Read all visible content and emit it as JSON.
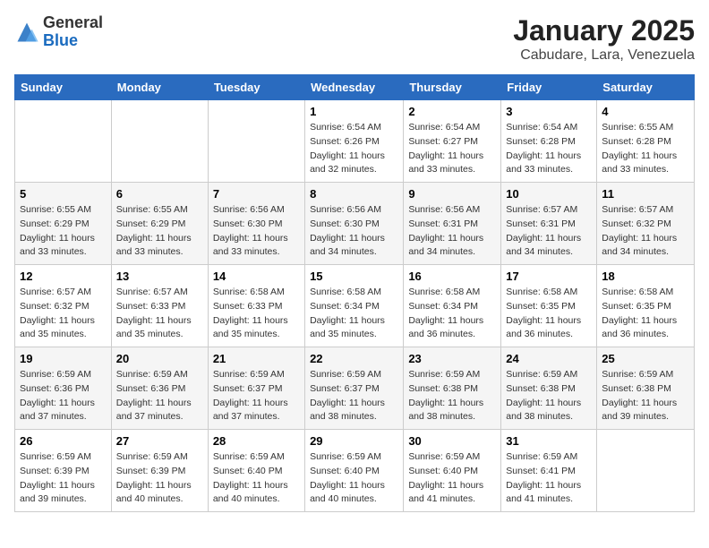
{
  "header": {
    "logo_general": "General",
    "logo_blue": "Blue",
    "month_title": "January 2025",
    "subtitle": "Cabudare, Lara, Venezuela"
  },
  "days_of_week": [
    "Sunday",
    "Monday",
    "Tuesday",
    "Wednesday",
    "Thursday",
    "Friday",
    "Saturday"
  ],
  "weeks": [
    [
      {
        "day": "",
        "sunrise": "",
        "sunset": "",
        "daylight": ""
      },
      {
        "day": "",
        "sunrise": "",
        "sunset": "",
        "daylight": ""
      },
      {
        "day": "",
        "sunrise": "",
        "sunset": "",
        "daylight": ""
      },
      {
        "day": "1",
        "sunrise": "Sunrise: 6:54 AM",
        "sunset": "Sunset: 6:26 PM",
        "daylight": "Daylight: 11 hours and 32 minutes."
      },
      {
        "day": "2",
        "sunrise": "Sunrise: 6:54 AM",
        "sunset": "Sunset: 6:27 PM",
        "daylight": "Daylight: 11 hours and 33 minutes."
      },
      {
        "day": "3",
        "sunrise": "Sunrise: 6:54 AM",
        "sunset": "Sunset: 6:28 PM",
        "daylight": "Daylight: 11 hours and 33 minutes."
      },
      {
        "day": "4",
        "sunrise": "Sunrise: 6:55 AM",
        "sunset": "Sunset: 6:28 PM",
        "daylight": "Daylight: 11 hours and 33 minutes."
      }
    ],
    [
      {
        "day": "5",
        "sunrise": "Sunrise: 6:55 AM",
        "sunset": "Sunset: 6:29 PM",
        "daylight": "Daylight: 11 hours and 33 minutes."
      },
      {
        "day": "6",
        "sunrise": "Sunrise: 6:55 AM",
        "sunset": "Sunset: 6:29 PM",
        "daylight": "Daylight: 11 hours and 33 minutes."
      },
      {
        "day": "7",
        "sunrise": "Sunrise: 6:56 AM",
        "sunset": "Sunset: 6:30 PM",
        "daylight": "Daylight: 11 hours and 33 minutes."
      },
      {
        "day": "8",
        "sunrise": "Sunrise: 6:56 AM",
        "sunset": "Sunset: 6:30 PM",
        "daylight": "Daylight: 11 hours and 34 minutes."
      },
      {
        "day": "9",
        "sunrise": "Sunrise: 6:56 AM",
        "sunset": "Sunset: 6:31 PM",
        "daylight": "Daylight: 11 hours and 34 minutes."
      },
      {
        "day": "10",
        "sunrise": "Sunrise: 6:57 AM",
        "sunset": "Sunset: 6:31 PM",
        "daylight": "Daylight: 11 hours and 34 minutes."
      },
      {
        "day": "11",
        "sunrise": "Sunrise: 6:57 AM",
        "sunset": "Sunset: 6:32 PM",
        "daylight": "Daylight: 11 hours and 34 minutes."
      }
    ],
    [
      {
        "day": "12",
        "sunrise": "Sunrise: 6:57 AM",
        "sunset": "Sunset: 6:32 PM",
        "daylight": "Daylight: 11 hours and 35 minutes."
      },
      {
        "day": "13",
        "sunrise": "Sunrise: 6:57 AM",
        "sunset": "Sunset: 6:33 PM",
        "daylight": "Daylight: 11 hours and 35 minutes."
      },
      {
        "day": "14",
        "sunrise": "Sunrise: 6:58 AM",
        "sunset": "Sunset: 6:33 PM",
        "daylight": "Daylight: 11 hours and 35 minutes."
      },
      {
        "day": "15",
        "sunrise": "Sunrise: 6:58 AM",
        "sunset": "Sunset: 6:34 PM",
        "daylight": "Daylight: 11 hours and 35 minutes."
      },
      {
        "day": "16",
        "sunrise": "Sunrise: 6:58 AM",
        "sunset": "Sunset: 6:34 PM",
        "daylight": "Daylight: 11 hours and 36 minutes."
      },
      {
        "day": "17",
        "sunrise": "Sunrise: 6:58 AM",
        "sunset": "Sunset: 6:35 PM",
        "daylight": "Daylight: 11 hours and 36 minutes."
      },
      {
        "day": "18",
        "sunrise": "Sunrise: 6:58 AM",
        "sunset": "Sunset: 6:35 PM",
        "daylight": "Daylight: 11 hours and 36 minutes."
      }
    ],
    [
      {
        "day": "19",
        "sunrise": "Sunrise: 6:59 AM",
        "sunset": "Sunset: 6:36 PM",
        "daylight": "Daylight: 11 hours and 37 minutes."
      },
      {
        "day": "20",
        "sunrise": "Sunrise: 6:59 AM",
        "sunset": "Sunset: 6:36 PM",
        "daylight": "Daylight: 11 hours and 37 minutes."
      },
      {
        "day": "21",
        "sunrise": "Sunrise: 6:59 AM",
        "sunset": "Sunset: 6:37 PM",
        "daylight": "Daylight: 11 hours and 37 minutes."
      },
      {
        "day": "22",
        "sunrise": "Sunrise: 6:59 AM",
        "sunset": "Sunset: 6:37 PM",
        "daylight": "Daylight: 11 hours and 38 minutes."
      },
      {
        "day": "23",
        "sunrise": "Sunrise: 6:59 AM",
        "sunset": "Sunset: 6:38 PM",
        "daylight": "Daylight: 11 hours and 38 minutes."
      },
      {
        "day": "24",
        "sunrise": "Sunrise: 6:59 AM",
        "sunset": "Sunset: 6:38 PM",
        "daylight": "Daylight: 11 hours and 38 minutes."
      },
      {
        "day": "25",
        "sunrise": "Sunrise: 6:59 AM",
        "sunset": "Sunset: 6:38 PM",
        "daylight": "Daylight: 11 hours and 39 minutes."
      }
    ],
    [
      {
        "day": "26",
        "sunrise": "Sunrise: 6:59 AM",
        "sunset": "Sunset: 6:39 PM",
        "daylight": "Daylight: 11 hours and 39 minutes."
      },
      {
        "day": "27",
        "sunrise": "Sunrise: 6:59 AM",
        "sunset": "Sunset: 6:39 PM",
        "daylight": "Daylight: 11 hours and 40 minutes."
      },
      {
        "day": "28",
        "sunrise": "Sunrise: 6:59 AM",
        "sunset": "Sunset: 6:40 PM",
        "daylight": "Daylight: 11 hours and 40 minutes."
      },
      {
        "day": "29",
        "sunrise": "Sunrise: 6:59 AM",
        "sunset": "Sunset: 6:40 PM",
        "daylight": "Daylight: 11 hours and 40 minutes."
      },
      {
        "day": "30",
        "sunrise": "Sunrise: 6:59 AM",
        "sunset": "Sunset: 6:40 PM",
        "daylight": "Daylight: 11 hours and 41 minutes."
      },
      {
        "day": "31",
        "sunrise": "Sunrise: 6:59 AM",
        "sunset": "Sunset: 6:41 PM",
        "daylight": "Daylight: 11 hours and 41 minutes."
      },
      {
        "day": "",
        "sunrise": "",
        "sunset": "",
        "daylight": ""
      }
    ]
  ]
}
